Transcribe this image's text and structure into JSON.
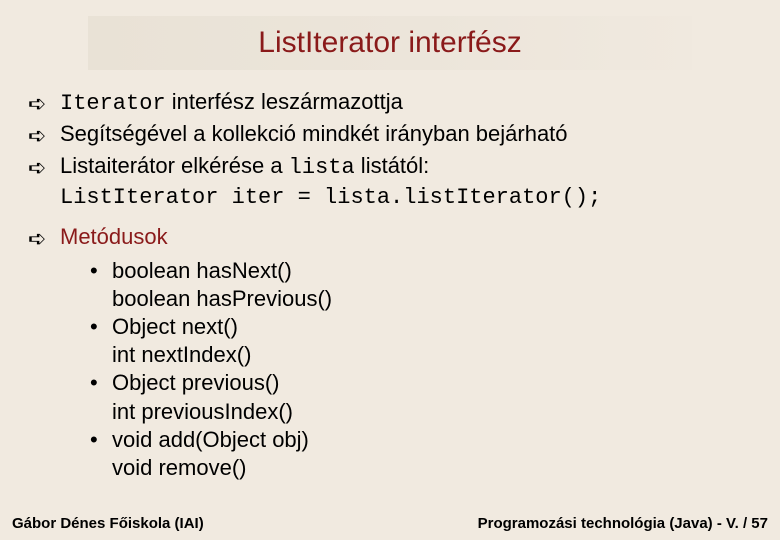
{
  "title": "ListIterator interfész",
  "bullets": {
    "b1": {
      "code": "Iterator",
      "rest": " interfész leszármazottja"
    },
    "b2": "Segítségével a kollekció mindkét irányban bejárható",
    "b3": {
      "pre": "Listaiterátor elkérése a ",
      "code1": "lista",
      "mid": " listától:",
      "codeLine": "ListIterator iter = lista.listIterator();"
    },
    "b4": "Metódusok"
  },
  "methods": [
    {
      "first": "boolean hasNext()",
      "second": "boolean hasPrevious()"
    },
    {
      "first": "Object next()",
      "second": "int nextIndex()"
    },
    {
      "first": "Object previous()",
      "second": "int previousIndex()"
    },
    {
      "first": "void add(Object obj)",
      "second": "void remove()"
    }
  ],
  "glyphs": {
    "arrow": "➪",
    "dot": "•"
  },
  "footer": {
    "left": "Gábor Dénes Főiskola (IAI)",
    "right": "Programozási technológia (Java)  -  V. / 57"
  }
}
